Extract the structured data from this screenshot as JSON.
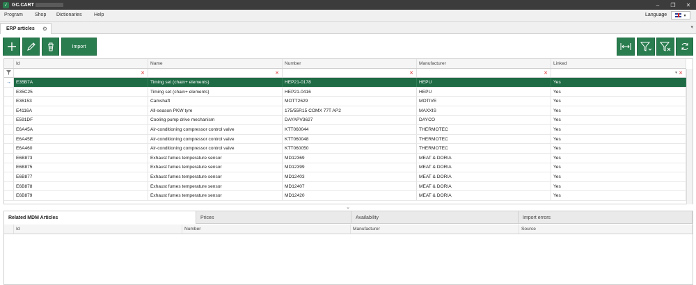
{
  "app": {
    "title": "GC.CART"
  },
  "menu": [
    "Program",
    "Shop",
    "Dictionaries",
    "Help"
  ],
  "language": {
    "label": "Language"
  },
  "tab": {
    "label": "ERP articles"
  },
  "toolbar": {
    "import_label": "Import"
  },
  "grid": {
    "columns": [
      "Id",
      "Name",
      "Number",
      "Manufacturer",
      "Linked"
    ],
    "rows": [
      [
        "E35B7A",
        "Timing set (chain+ elements)",
        "HEP21-0178",
        "HEPU",
        "Yes"
      ],
      [
        "E35C25",
        "Timing set (chain+ elements)",
        "HEP21-0416",
        "HEPU",
        "Yes"
      ],
      [
        "E36153",
        "Camshaft",
        "MOTT2629",
        "MOTIVE",
        "Yes"
      ],
      [
        "E4116A",
        "All-season PKW tyre",
        "175/55R15 COMX 77T AP2",
        "MAXXIS",
        "Yes"
      ],
      [
        "E591DF",
        "Cooling pump drive mechanism",
        "DAYAPV3627",
        "DAYCO",
        "Yes"
      ],
      [
        "E6A45A",
        "Air-conditioning compressor control valve",
        "KTT060044",
        "THERMOTEC",
        "Yes"
      ],
      [
        "E6A45E",
        "Air-conditioning compressor control valve",
        "KTT060048",
        "THERMOTEC",
        "Yes"
      ],
      [
        "E6A460",
        "Air-conditioning compressor control valve",
        "KTT060050",
        "THERMOTEC",
        "Yes"
      ],
      [
        "E6B873",
        "Exhaust fumes temperature sensor",
        "MD12369",
        "MEAT & DORIA",
        "Yes"
      ],
      [
        "E6B875",
        "Exhaust fumes temperature sensor",
        "MD12399",
        "MEAT & DORIA",
        "Yes"
      ],
      [
        "E6B877",
        "Exhaust fumes temperature sensor",
        "MD12403",
        "MEAT & DORIA",
        "Yes"
      ],
      [
        "E6B878",
        "Exhaust fumes temperature sensor",
        "MD12407",
        "MEAT & DORIA",
        "Yes"
      ],
      [
        "E6B879",
        "Exhaust fumes temperature sensor",
        "MD12420",
        "MEAT & DORIA",
        "Yes"
      ]
    ],
    "selected_index": 0
  },
  "lower": {
    "tabs": [
      "Related MDM Articles",
      "Prices",
      "Availability",
      "Import errors"
    ],
    "columns": [
      "Id",
      "Number",
      "Manufacturer",
      "Source"
    ]
  },
  "colors": {
    "accent": "#2a7d4f",
    "selected_row": "#1e6b46"
  }
}
